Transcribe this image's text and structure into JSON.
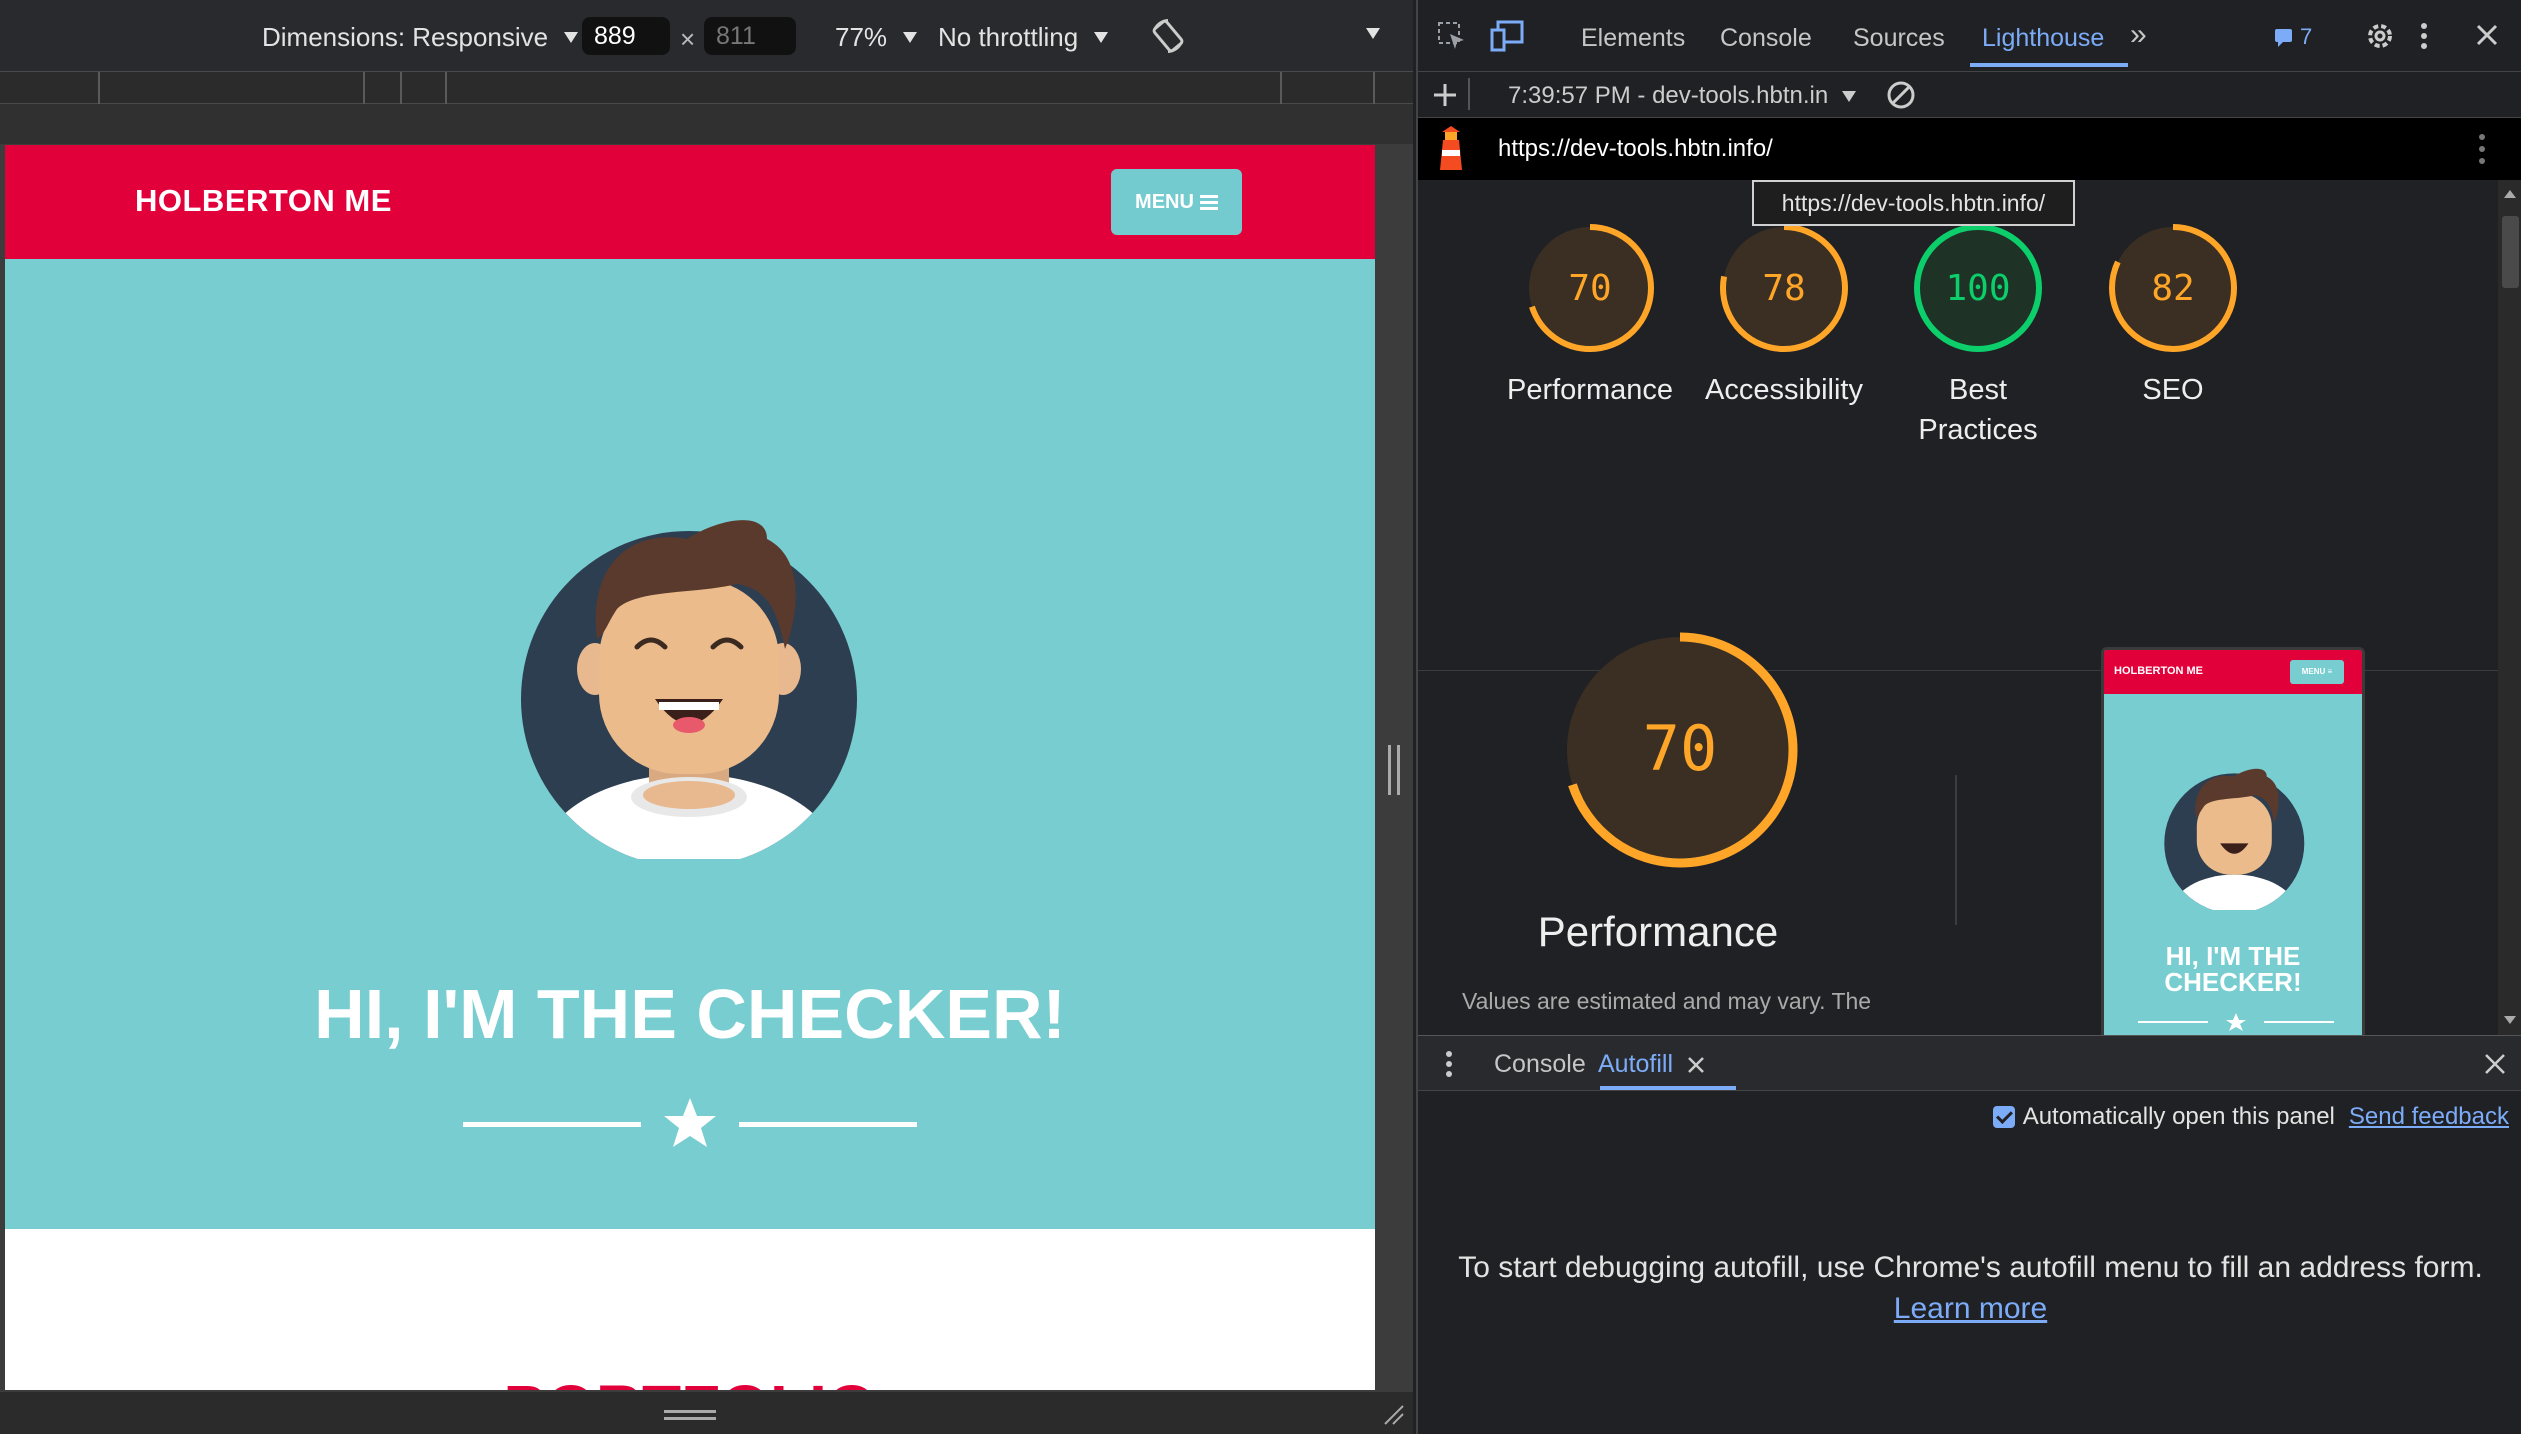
{
  "emulation": {
    "dimensions_label": "Dimensions: Responsive",
    "width_value": "889",
    "height_value": "811",
    "times": "×",
    "zoom": "77%",
    "throttling": "No throttling"
  },
  "site": {
    "logo": "HOLBERTON ME",
    "menu_label": "MENU",
    "hero_title": "HI, I'M THE CHECKER!",
    "next_section": "PORTFOLIO"
  },
  "devtools": {
    "tabs": [
      "Elements",
      "Console",
      "Sources",
      "Lighthouse"
    ],
    "active_tab": "Lighthouse",
    "issues_count": "7",
    "report_selector": "7:39:57 PM - dev-tools.hbtn.in",
    "url": "https://dev-tools.hbtn.info/",
    "tooltip": "https://dev-tools.hbtn.info/",
    "scores": [
      {
        "value": "70",
        "label": "Performance",
        "color": "#ffa629"
      },
      {
        "value": "78",
        "label": "Accessibility",
        "color": "#ffa629"
      },
      {
        "value": "100",
        "label": "Best Practices",
        "color": "#0cce6b"
      },
      {
        "value": "82",
        "label": "SEO",
        "color": "#ffa629"
      }
    ],
    "big_score": "70",
    "big_label": "Performance",
    "note": "Values are estimated and may vary. The",
    "thumb": {
      "logo": "HOLBERTON ME",
      "menu": "MENU ≡",
      "title": "HI, I'M THE CHECKER!"
    }
  },
  "drawer": {
    "tabs": [
      "Console",
      "Autofill"
    ],
    "active_tab": "Autofill",
    "auto_open_label": "Automatically open this panel",
    "send_feedback": "Send feedback",
    "message": "To start debugging autofill, use Chrome's autofill menu to fill an address form.",
    "learn_more": "Learn more"
  }
}
